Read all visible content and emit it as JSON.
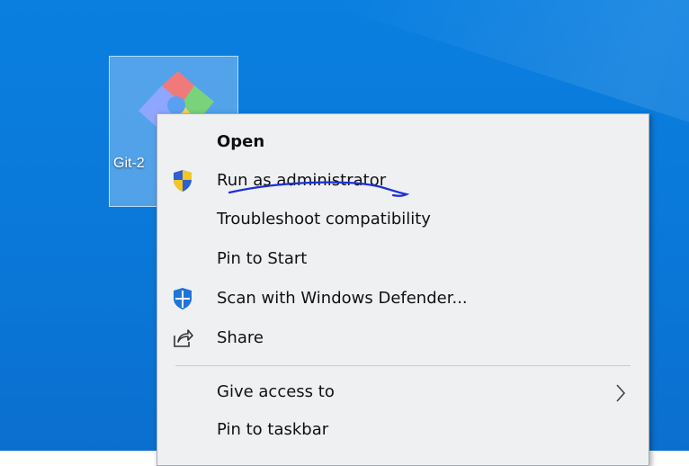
{
  "desktop": {
    "icon": {
      "label": "Git-2"
    }
  },
  "context_menu": {
    "items": [
      {
        "label": "Open",
        "bold": true
      },
      {
        "label": "Run as administrator",
        "icon": "uac-shield-icon"
      },
      {
        "label": "Troubleshoot compatibility"
      },
      {
        "label": "Pin to Start"
      },
      {
        "label": "Scan with Windows Defender...",
        "icon": "windows-defender-icon"
      },
      {
        "label": "Share",
        "icon": "share-icon"
      },
      {
        "label": "Give access to",
        "submenu": true
      },
      {
        "label": "Pin to taskbar"
      }
    ]
  },
  "colors": {
    "desktop_background": "#0a78d8",
    "menu_background": "#eef0f2",
    "pen_annotation": "#1c2fd6"
  }
}
